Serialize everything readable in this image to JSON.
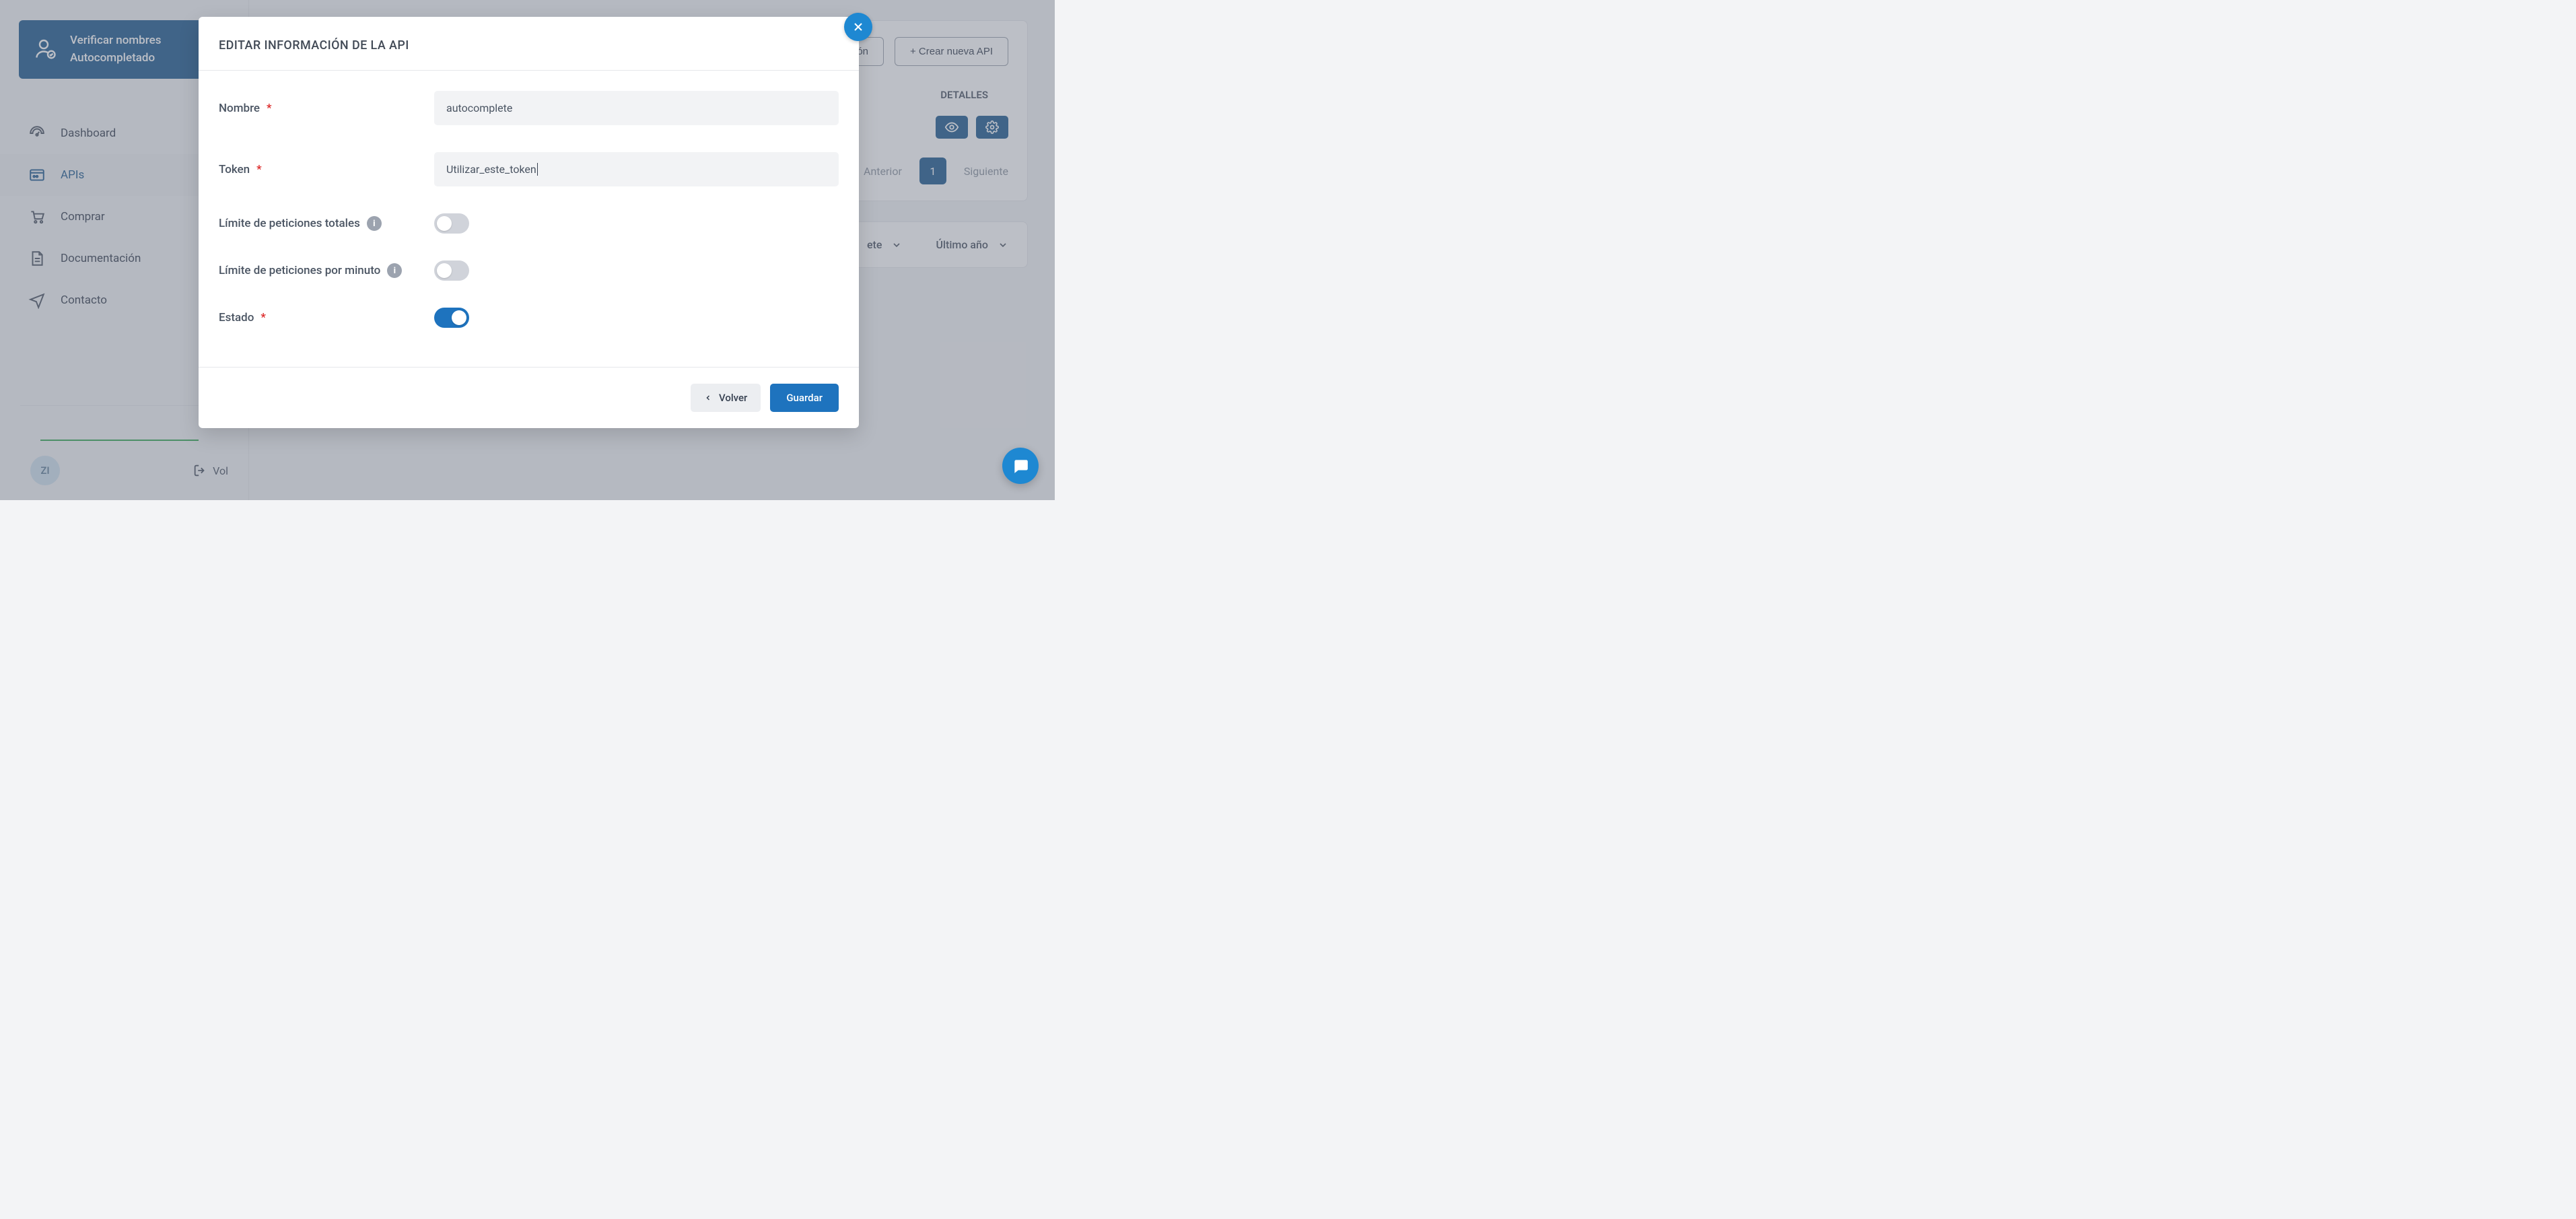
{
  "sidebar": {
    "verify": {
      "line1": "Verificar nombres",
      "line2": "Autocompletado"
    },
    "nav": [
      {
        "label": "Dashboard"
      },
      {
        "label": "APIs"
      },
      {
        "label": "Comprar"
      },
      {
        "label": "Documentación"
      },
      {
        "label": "Contacto"
      }
    ],
    "user_initials": "ZI",
    "logout_label": "Vol"
  },
  "main": {
    "buttons": {
      "documentation_suffix": "ón",
      "create_api": "+ Crear nueva API"
    },
    "table": {
      "details_header": "DETALLES"
    },
    "pagination": {
      "prev": "Anterior",
      "current": "1",
      "next": "Siguiente"
    },
    "filters": {
      "left_suffix": "ete",
      "right": "Último año"
    }
  },
  "modal": {
    "title": "EDITAR INFORMACIÓN DE LA API",
    "fields": {
      "name_label": "Nombre",
      "name_value": "autocomplete",
      "token_label": "Token",
      "token_value": "Utilizar_este_token",
      "limit_total_label": "Límite de peticiones totales",
      "limit_minute_label": "Límite de peticiones por minuto",
      "status_label": "Estado"
    },
    "toggles": {
      "limit_total": false,
      "limit_minute": false,
      "status": true
    },
    "footer": {
      "back": "Volver",
      "save": "Guardar"
    }
  }
}
